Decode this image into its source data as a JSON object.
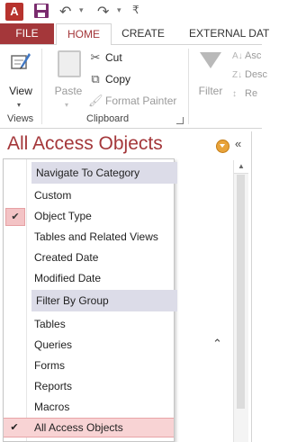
{
  "qat": {
    "app_letter": "A",
    "undo": "↶",
    "redo": "↷",
    "dropdown": "▾",
    "customize": "₹"
  },
  "tabs": {
    "file": "FILE",
    "home": "HOME",
    "create": "CREATE",
    "external": "EXTERNAL DAT"
  },
  "ribbon": {
    "view": {
      "label": "View",
      "caret": "▾"
    },
    "views_group": "Views",
    "paste": {
      "label": "Paste",
      "caret": "▾"
    },
    "cut": "Cut",
    "copy": "Copy",
    "format_painter": "Format Painter",
    "clipboard_group": "Clipboard",
    "filter": "Filter",
    "sort_asc": "Asc",
    "sort_desc": "Desc",
    "remove_sort": "Re"
  },
  "nav": {
    "title": "All Access Objects",
    "collapse": "«",
    "expand": "⌃"
  },
  "menu": {
    "navigate_header": "Navigate To Category",
    "categories": [
      {
        "label": "Custom",
        "checked": false
      },
      {
        "label": "Object Type",
        "checked": true
      },
      {
        "label": "Tables and Related Views",
        "checked": false
      },
      {
        "label": "Created Date",
        "checked": false
      },
      {
        "label": "Modified Date",
        "checked": false
      }
    ],
    "filter_header": "Filter By Group",
    "groups": [
      {
        "label": "Tables",
        "checked": false
      },
      {
        "label": "Queries",
        "checked": false
      },
      {
        "label": "Forms",
        "checked": false
      },
      {
        "label": "Reports",
        "checked": false
      },
      {
        "label": "Macros",
        "checked": false
      },
      {
        "label": "All Access Objects",
        "checked": true
      }
    ],
    "check_mark": "✔"
  },
  "colors": {
    "accent": "#a4373a",
    "header_bg": "#dcdce8",
    "selected_bg": "#f8d3d4"
  }
}
